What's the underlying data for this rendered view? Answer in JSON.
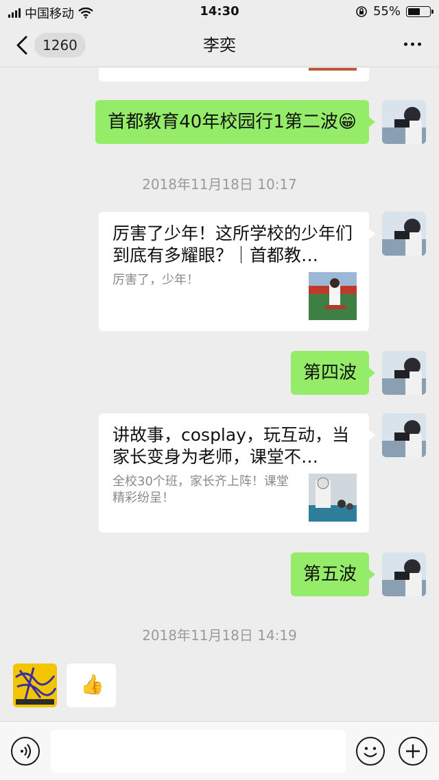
{
  "status_bar": {
    "carrier": "中国移动",
    "time": "14:30",
    "battery_percent": "55%",
    "battery_level": 0.55
  },
  "nav": {
    "unread_count": "1260",
    "title": "李奕"
  },
  "messages": {
    "m1": {
      "text": "首都教育40年校园行1第二波😁"
    },
    "ts1": {
      "text": "2018年11月18日 10:17"
    },
    "card1": {
      "title": "厉害了少年！这所学校的少年们到底有多耀眼？｜首都教…",
      "desc": "厉害了，少年！"
    },
    "m2": {
      "text": "第四波"
    },
    "card2": {
      "title": "讲故事，cosplay，玩互动，当家长变身为老师，课堂不…",
      "desc": "全校30个班，家长齐上阵！课堂精彩纷呈！"
    },
    "m3": {
      "text": "第五波"
    },
    "ts2": {
      "text": "2018年11月18日 14:19"
    },
    "m4": {
      "text": "👍"
    }
  },
  "input": {
    "placeholder": ""
  },
  "colors": {
    "sent_bubble": "#95ec69",
    "background": "#ededed",
    "timestamp": "#9a9a9a"
  }
}
